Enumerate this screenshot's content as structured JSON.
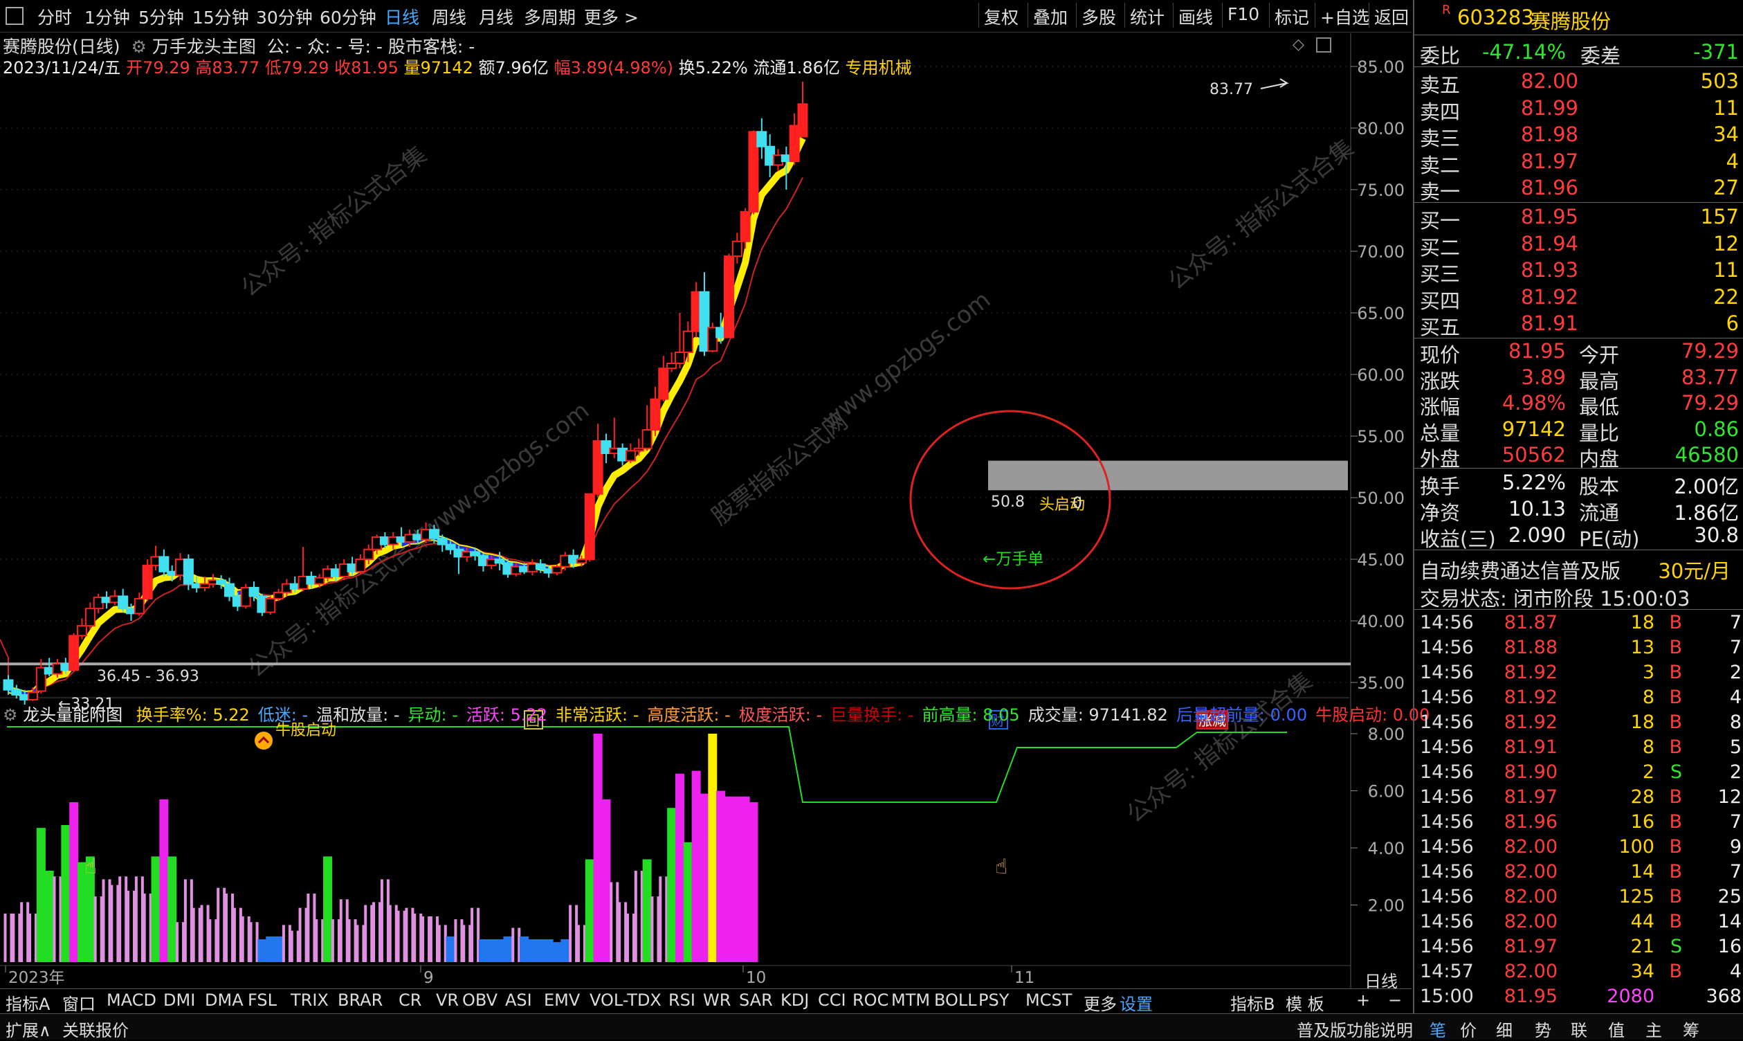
{
  "toolbar": {
    "tabs": [
      "分时",
      "1分钟",
      "5分钟",
      "15分钟",
      "30分钟",
      "60分钟",
      "日线",
      "周线",
      "月线",
      "多周期",
      "更多 >"
    ],
    "active_tab": "日线",
    "tools": [
      "复权",
      "叠加",
      "多股",
      "统计",
      "画线",
      "F10",
      "标记",
      "+自选",
      "返回"
    ]
  },
  "stock": {
    "title_line": "赛腾股份(日线)",
    "indicator_name": "万手龙头主图",
    "indicator_params": "公: - 众: - 号: - 股市客栈: -",
    "date": "2023/11/24/五",
    "open": "开79.29",
    "high": "高83.77",
    "low": "低79.29",
    "close": "收81.95",
    "volume": "量97142",
    "amount": "额7.96亿",
    "change": "幅3.89(4.98%)",
    "turnover": "换5.22%",
    "float_cap": "流通1.86亿",
    "sector": "专用机械"
  },
  "chart_labels": {
    "high_marker": "83.77",
    "low_marker": "33.21",
    "range_label": "36.45 - 36.93",
    "box_label": "50.8",
    "box_label_2": "头启动",
    "box_label_3": "0",
    "wanshou": "←万手单",
    "x_axis": [
      "2023年",
      "9",
      "10",
      "11"
    ],
    "events": [
      "回",
      "财",
      "涨减"
    ],
    "watermarks": [
      "公众号: 指标公式合集",
      "www.gpzbgs.com",
      "股票指标公式网"
    ]
  },
  "price_axis": [
    "85.00",
    "80.00",
    "75.00",
    "70.00",
    "65.00",
    "60.00",
    "55.00",
    "50.00",
    "45.00",
    "40.00",
    "35.00"
  ],
  "vol_axis": [
    "8.00",
    "6.00",
    "4.00",
    "2.00"
  ],
  "indicator": {
    "name": "龙头量能附图",
    "params": [
      {
        "text": "换手率%: 5.22",
        "color": "#ffd400"
      },
      {
        "text": "低迷: -",
        "color": "#4aa8ff"
      },
      {
        "text": "温和放量: -",
        "color": "#dddddd"
      },
      {
        "text": "异动: -",
        "color": "#2ee62e"
      },
      {
        "text": "活跃: 5.22",
        "color": "#ff44ff"
      },
      {
        "text": "非常活跃: -",
        "color": "#ffd400"
      },
      {
        "text": "高度活跃: -",
        "color": "#ff9933"
      },
      {
        "text": "极度活跃: -",
        "color": "#ff5555"
      },
      {
        "text": "巨量换手: -",
        "color": "#cc0000"
      },
      {
        "text": "前高量: 8.05",
        "color": "#2ee62e"
      },
      {
        "text": "成交量: 97141.82",
        "color": "#dddddd"
      },
      {
        "text": "后量超前量: 0.00",
        "color": "#3366ff"
      },
      {
        "text": "牛股启动: 0.00",
        "color": "#ff3333"
      }
    ],
    "launch_label": "牛股启动"
  },
  "right_panel": {
    "code": "603283",
    "name": "赛腾股份",
    "r_badge": "R",
    "weibi_label": "委比",
    "weibi": "-47.14%",
    "weicha_label": "委差",
    "weicha": "-371",
    "asks": [
      {
        "label": "卖五",
        "price": "82.00",
        "vol": "503"
      },
      {
        "label": "卖四",
        "price": "81.99",
        "vol": "11"
      },
      {
        "label": "卖三",
        "price": "81.98",
        "vol": "34"
      },
      {
        "label": "卖二",
        "price": "81.97",
        "vol": "4"
      },
      {
        "label": "卖一",
        "price": "81.96",
        "vol": "27"
      }
    ],
    "bids": [
      {
        "label": "买一",
        "price": "81.95",
        "vol": "157"
      },
      {
        "label": "买二",
        "price": "81.94",
        "vol": "12"
      },
      {
        "label": "买三",
        "price": "81.93",
        "vol": "11"
      },
      {
        "label": "买四",
        "price": "81.92",
        "vol": "22"
      },
      {
        "label": "买五",
        "price": "81.91",
        "vol": "6"
      }
    ],
    "quote": [
      {
        "l1": "现价",
        "v1": "81.95",
        "c1": "#ff3b3b",
        "l2": "今开",
        "v2": "79.29",
        "c2": "#ff3b3b"
      },
      {
        "l1": "涨跌",
        "v1": "3.89",
        "c1": "#ff3b3b",
        "l2": "最高",
        "v2": "83.77",
        "c2": "#ff3b3b"
      },
      {
        "l1": "涨幅",
        "v1": "4.98%",
        "c1": "#ff3b3b",
        "l2": "最低",
        "v2": "79.29",
        "c2": "#ff3b3b"
      },
      {
        "l1": "总量",
        "v1": "97142",
        "c1": "#ffd400",
        "l2": "量比",
        "v2": "0.86",
        "c2": "#2ee62e"
      },
      {
        "l1": "外盘",
        "v1": "50562",
        "c1": "#ff3b3b",
        "l2": "内盘",
        "v2": "46580",
        "c2": "#2ee62e"
      }
    ],
    "fund": [
      {
        "l1": "换手",
        "v1": "5.22%",
        "l2": "股本",
        "v2": "2.00亿"
      },
      {
        "l1": "净资",
        "v1": "10.13",
        "l2": "流通",
        "v2": "1.86亿"
      },
      {
        "l1": "收益(三)",
        "v1": "2.090",
        "l2": "PE(动)",
        "v2": "30.8"
      }
    ],
    "promo": "自动续费通达信普及版",
    "promo_price": "30元/月",
    "trade_status": "交易状态: 闭市阶段 15:00:03",
    "ticks": [
      {
        "t": "14:56",
        "p": "81.87",
        "v": "18",
        "s": "B",
        "n": "7"
      },
      {
        "t": "14:56",
        "p": "81.88",
        "v": "13",
        "s": "B",
        "n": "7"
      },
      {
        "t": "14:56",
        "p": "81.92",
        "v": "3",
        "s": "B",
        "n": "2"
      },
      {
        "t": "14:56",
        "p": "81.92",
        "v": "8",
        "s": "B",
        "n": "4"
      },
      {
        "t": "14:56",
        "p": "81.92",
        "v": "18",
        "s": "B",
        "n": "8"
      },
      {
        "t": "14:56",
        "p": "81.91",
        "v": "8",
        "s": "B",
        "n": "5"
      },
      {
        "t": "14:56",
        "p": "81.90",
        "v": "2",
        "s": "S",
        "n": "2"
      },
      {
        "t": "14:56",
        "p": "81.97",
        "v": "28",
        "s": "B",
        "n": "12"
      },
      {
        "t": "14:56",
        "p": "81.96",
        "v": "16",
        "s": "B",
        "n": "7"
      },
      {
        "t": "14:56",
        "p": "82.00",
        "v": "100",
        "s": "B",
        "n": "9"
      },
      {
        "t": "14:56",
        "p": "82.00",
        "v": "14",
        "s": "B",
        "n": "7"
      },
      {
        "t": "14:56",
        "p": "82.00",
        "v": "125",
        "s": "B",
        "n": "25"
      },
      {
        "t": "14:56",
        "p": "82.00",
        "v": "44",
        "s": "B",
        "n": "14"
      },
      {
        "t": "14:56",
        "p": "81.97",
        "v": "21",
        "s": "S",
        "n": "16"
      },
      {
        "t": "14:57",
        "p": "82.00",
        "v": "34",
        "s": "B",
        "n": "4"
      },
      {
        "t": "15:00",
        "p": "81.95",
        "v": "2080",
        "s": "",
        "n": "368"
      }
    ]
  },
  "bottom_tabs": [
    "指标A",
    "窗口",
    "MACD",
    "DMI",
    "DMA",
    "FSL",
    "TRIX",
    "BRAR",
    "CR",
    "VR",
    "OBV",
    "ASI",
    "EMV",
    "VOL-TDX",
    "RSI",
    "WR",
    "SAR",
    "KDJ",
    "CCI",
    "ROC",
    "MTM",
    "BOLL",
    "PSY",
    "MCST",
    "更多",
    "设置",
    "指标B",
    "模 板"
  ],
  "bottom_active": "设置",
  "period_label": "日线",
  "status_bar": {
    "left": [
      "扩展∧",
      "关联报价"
    ],
    "right": [
      "普及版功能说明",
      "笔",
      "价",
      "细",
      "势",
      "联",
      "值",
      "主",
      "筹"
    ]
  },
  "chart_data": {
    "type": "candlestick",
    "x_axis_labels": [
      "2023年",
      "9",
      "10",
      "11"
    ],
    "ylim": [
      32,
      87
    ],
    "candles": [
      [
        35.2,
        34.4,
        35.6,
        34.0
      ],
      [
        34.4,
        34.0,
        34.8,
        33.7
      ],
      [
        34.0,
        33.6,
        34.4,
        33.2
      ],
      [
        33.6,
        34.2,
        34.6,
        33.5
      ],
      [
        34.3,
        36.2,
        36.9,
        34.1
      ],
      [
        36.2,
        35.7,
        37.0,
        35.5
      ],
      [
        35.7,
        36.5,
        36.9,
        35.4
      ],
      [
        36.5,
        36.0,
        37.0,
        35.7
      ],
      [
        36.0,
        38.8,
        39.0,
        35.9
      ],
      [
        38.8,
        39.6,
        40.2,
        38.5
      ],
      [
        39.6,
        41.0,
        41.5,
        39.3
      ],
      [
        41.0,
        41.9,
        42.2,
        40.6
      ],
      [
        41.9,
        41.5,
        42.4,
        41.0
      ],
      [
        41.5,
        42.0,
        42.5,
        41.3
      ],
      [
        42.0,
        41.0,
        42.6,
        40.7
      ],
      [
        41.0,
        40.6,
        41.4,
        40.0
      ],
      [
        40.6,
        41.8,
        42.3,
        40.4
      ],
      [
        41.8,
        44.5,
        45.0,
        41.6
      ],
      [
        44.5,
        45.2,
        46.1,
        44.1
      ],
      [
        45.2,
        44.0,
        45.8,
        43.6
      ],
      [
        44.0,
        43.7,
        44.5,
        43.2
      ],
      [
        43.7,
        45.0,
        45.5,
        43.3
      ],
      [
        45.0,
        43.0,
        45.4,
        42.5
      ],
      [
        43.0,
        42.7,
        43.6,
        42.3
      ],
      [
        42.7,
        43.0,
        43.6,
        42.4
      ],
      [
        43.0,
        43.3,
        43.8,
        42.7
      ],
      [
        43.3,
        43.0,
        43.7,
        42.6
      ],
      [
        43.0,
        42.0,
        43.5,
        41.6
      ],
      [
        42.0,
        41.2,
        42.3,
        40.8
      ],
      [
        41.2,
        42.7,
        43.0,
        41.0
      ],
      [
        42.7,
        42.0,
        43.2,
        41.6
      ],
      [
        42.0,
        40.7,
        42.2,
        40.4
      ],
      [
        40.7,
        41.8,
        42.0,
        40.5
      ],
      [
        41.8,
        42.3,
        42.6,
        41.6
      ],
      [
        42.3,
        43.0,
        43.4,
        42.0
      ],
      [
        43.0,
        42.6,
        43.6,
        42.3
      ],
      [
        42.6,
        43.6,
        46.0,
        42.4
      ],
      [
        43.6,
        43.0,
        44.0,
        42.6
      ],
      [
        43.0,
        43.5,
        43.8,
        42.7
      ],
      [
        43.5,
        44.2,
        44.5,
        43.2
      ],
      [
        44.2,
        43.6,
        44.6,
        43.2
      ],
      [
        43.6,
        44.6,
        45.0,
        43.3
      ],
      [
        44.6,
        44.0,
        45.2,
        43.7
      ],
      [
        44.0,
        45.0,
        45.4,
        43.8
      ],
      [
        45.0,
        45.8,
        46.2,
        44.6
      ],
      [
        45.8,
        46.8,
        47.0,
        45.4
      ],
      [
        46.8,
        46.2,
        47.2,
        45.9
      ],
      [
        46.2,
        46.8,
        47.2,
        45.8
      ],
      [
        46.8,
        46.4,
        47.6,
        46.1
      ],
      [
        46.4,
        47.0,
        47.4,
        46.0
      ],
      [
        47.0,
        46.6,
        47.4,
        46.2
      ],
      [
        46.6,
        47.4,
        48.0,
        46.3
      ],
      [
        47.4,
        46.7,
        47.8,
        46.3
      ],
      [
        46.7,
        46.2,
        47.0,
        45.6
      ],
      [
        46.2,
        45.8,
        46.5,
        45.4
      ],
      [
        45.8,
        45.2,
        46.1,
        43.8
      ],
      [
        45.2,
        45.6,
        46.0,
        44.8
      ],
      [
        45.6,
        45.3,
        45.9,
        44.9
      ],
      [
        45.3,
        44.5,
        45.5,
        44.0
      ],
      [
        44.5,
        45.0,
        45.3,
        44.2
      ],
      [
        45.0,
        44.7,
        45.6,
        44.1
      ],
      [
        44.7,
        43.8,
        45.0,
        43.5
      ],
      [
        43.8,
        44.4,
        44.7,
        43.6
      ],
      [
        44.4,
        44.0,
        44.7,
        43.8
      ],
      [
        44.0,
        44.6,
        45.0,
        43.7
      ],
      [
        44.6,
        44.2,
        45.0,
        43.9
      ],
      [
        44.2,
        43.9,
        44.5,
        43.5
      ],
      [
        43.9,
        44.4,
        44.6,
        43.7
      ],
      [
        44.4,
        45.3,
        45.6,
        44.1
      ],
      [
        45.3,
        44.7,
        45.8,
        44.3
      ],
      [
        44.7,
        45.0,
        45.3,
        44.4
      ],
      [
        45.0,
        50.3,
        50.3,
        44.8
      ],
      [
        50.3,
        54.6,
        56.0,
        50.0
      ],
      [
        54.6,
        53.6,
        55.2,
        52.8
      ],
      [
        53.6,
        54.0,
        56.5,
        53.2
      ],
      [
        54.0,
        53.0,
        54.4,
        52.6
      ],
      [
        53.0,
        53.8,
        54.4,
        52.8
      ],
      [
        53.8,
        54.0,
        54.8,
        53.4
      ],
      [
        54.0,
        55.5,
        57.5,
        53.8
      ],
      [
        55.5,
        58.0,
        59.0,
        55.0
      ],
      [
        58.0,
        60.5,
        61.5,
        57.8
      ],
      [
        60.5,
        60.9,
        61.8,
        60.2
      ],
      [
        60.9,
        61.8,
        65.0,
        60.5
      ],
      [
        61.8,
        63.5,
        64.3,
        61.0
      ],
      [
        63.5,
        66.7,
        67.5,
        63.0
      ],
      [
        66.7,
        61.9,
        68.3,
        61.5
      ],
      [
        61.9,
        63.8,
        64.2,
        61.8
      ],
      [
        63.8,
        63.0,
        65.0,
        62.5
      ],
      [
        63.0,
        69.6,
        69.8,
        63.0
      ],
      [
        69.6,
        70.8,
        71.5,
        69.0
      ],
      [
        70.8,
        73.2,
        73.5,
        70.2
      ],
      [
        73.2,
        79.7,
        79.8,
        73.0
      ],
      [
        79.7,
        78.5,
        80.8,
        77.5
      ],
      [
        78.5,
        77.0,
        79.5,
        76.0
      ],
      [
        77.0,
        77.8,
        78.3,
        76.5
      ],
      [
        77.8,
        77.3,
        78.5,
        75.0
      ],
      [
        77.3,
        80.2,
        81.2,
        77.0
      ],
      [
        79.3,
        81.95,
        83.77,
        79.29
      ]
    ],
    "volume": [
      [
        1.7,
        "pink"
      ],
      [
        1.7,
        "pink"
      ],
      [
        2.1,
        "pink"
      ],
      [
        1.7,
        "pink"
      ],
      [
        4.7,
        "green"
      ],
      [
        3.2,
        "green"
      ],
      [
        3.0,
        "pink"
      ],
      [
        4.8,
        "green"
      ],
      [
        5.6,
        "magenta"
      ],
      [
        3.5,
        "green"
      ],
      [
        3.7,
        "green"
      ],
      [
        2.3,
        "pink"
      ],
      [
        2.9,
        "pink"
      ],
      [
        2.7,
        "pink"
      ],
      [
        3.0,
        "pink"
      ],
      [
        2.5,
        "pink"
      ],
      [
        3.0,
        "pink"
      ],
      [
        2.4,
        "pink"
      ],
      [
        3.7,
        "green"
      ],
      [
        5.7,
        "magenta"
      ],
      [
        3.7,
        "green"
      ],
      [
        1.4,
        "pink"
      ],
      [
        2.9,
        "pink"
      ],
      [
        1.9,
        "pink"
      ],
      [
        2.0,
        "pink"
      ],
      [
        1.5,
        "pink"
      ],
      [
        2.6,
        "pink"
      ],
      [
        2.4,
        "pink"
      ],
      [
        1.9,
        "pink"
      ],
      [
        1.6,
        "pink"
      ],
      [
        1.4,
        "pink"
      ],
      [
        0.8,
        "blue"
      ],
      [
        0.9,
        "blue"
      ],
      [
        0.9,
        "blue"
      ],
      [
        1.3,
        "pink"
      ],
      [
        1.1,
        "pink"
      ],
      [
        1.9,
        "pink"
      ],
      [
        2.4,
        "pink"
      ],
      [
        1.5,
        "pink"
      ],
      [
        3.7,
        "green"
      ],
      [
        1.5,
        "pink"
      ],
      [
        2.2,
        "pink"
      ],
      [
        1.5,
        "pink"
      ],
      [
        1.3,
        "pink"
      ],
      [
        2.0,
        "pink"
      ],
      [
        2.1,
        "pink"
      ],
      [
        2.9,
        "pink"
      ],
      [
        2.0,
        "pink"
      ],
      [
        1.8,
        "pink"
      ],
      [
        1.9,
        "pink"
      ],
      [
        1.7,
        "pink"
      ],
      [
        1.6,
        "pink"
      ],
      [
        1.6,
        "pink"
      ],
      [
        1.3,
        "pink"
      ],
      [
        0.9,
        "blue"
      ],
      [
        1.5,
        "pink"
      ],
      [
        1.3,
        "pink"
      ],
      [
        1.9,
        "pink"
      ],
      [
        0.8,
        "blue"
      ],
      [
        0.8,
        "blue"
      ],
      [
        0.8,
        "blue"
      ],
      [
        0.9,
        "blue"
      ],
      [
        1.2,
        "pink"
      ],
      [
        0.9,
        "blue"
      ],
      [
        0.8,
        "blue"
      ],
      [
        0.8,
        "blue"
      ],
      [
        0.8,
        "blue"
      ],
      [
        0.7,
        "blue"
      ],
      [
        0.8,
        "blue"
      ],
      [
        2.0,
        "pink"
      ],
      [
        1.3,
        "pink"
      ],
      [
        3.6,
        "green"
      ],
      [
        8.0,
        "magenta"
      ],
      [
        5.7,
        "magenta"
      ],
      [
        2.8,
        "pink"
      ],
      [
        2.1,
        "pink"
      ],
      [
        1.7,
        "pink"
      ],
      [
        3.2,
        "pink"
      ],
      [
        3.6,
        "green"
      ],
      [
        2.3,
        "pink"
      ],
      [
        3.0,
        "pink"
      ],
      [
        5.4,
        "green"
      ],
      [
        6.6,
        "magenta"
      ],
      [
        4.2,
        "green"
      ],
      [
        6.7,
        "magenta"
      ],
      [
        5.9,
        "magenta"
      ],
      [
        8.0,
        "yellow"
      ],
      [
        6.0,
        "magenta"
      ],
      [
        5.8,
        "magenta"
      ],
      [
        5.8,
        "magenta"
      ],
      [
        5.8,
        "magenta"
      ],
      [
        5.6,
        "magenta"
      ]
    ],
    "vol_ylim": [
      0,
      10
    ],
    "prev_high_volume": "8.05"
  }
}
